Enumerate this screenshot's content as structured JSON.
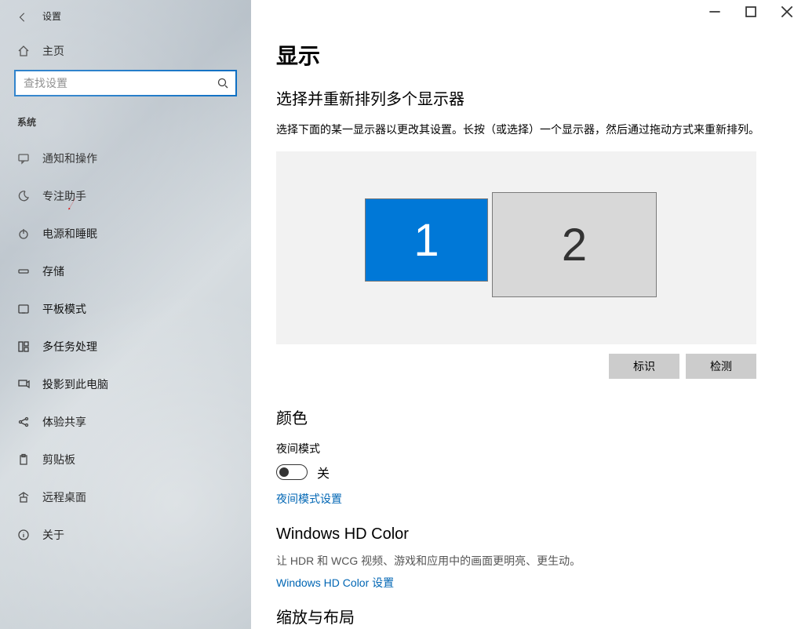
{
  "window": {
    "title": "设置"
  },
  "sidebar": {
    "home": "主页",
    "search_placeholder": "查找设置",
    "category": "系统",
    "items": [
      {
        "label": "通知和操作"
      },
      {
        "label": "专注助手"
      },
      {
        "label": "电源和睡眠"
      },
      {
        "label": "存储"
      },
      {
        "label": "平板模式"
      },
      {
        "label": "多任务处理"
      },
      {
        "label": "投影到此电脑"
      },
      {
        "label": "体验共享"
      },
      {
        "label": "剪贴板"
      },
      {
        "label": "远程桌面"
      },
      {
        "label": "关于"
      }
    ]
  },
  "main": {
    "title": "显示",
    "arrange_heading": "选择并重新排列多个显示器",
    "arrange_desc": "选择下面的某一显示器以更改其设置。长按（或选择）一个显示器，然后通过拖动方式来重新排列。",
    "display1": "1",
    "display2": "2",
    "identify": "标识",
    "detect": "检测",
    "color_heading": "颜色",
    "night_label": "夜间模式",
    "night_state": "关",
    "night_link": "夜间模式设置",
    "hd_title": "Windows HD Color",
    "hd_desc": "让 HDR 和 WCG 视频、游戏和应用中的画面更明亮、更生动。",
    "hd_link": "Windows HD Color 设置",
    "scale_heading": "缩放与布局"
  }
}
